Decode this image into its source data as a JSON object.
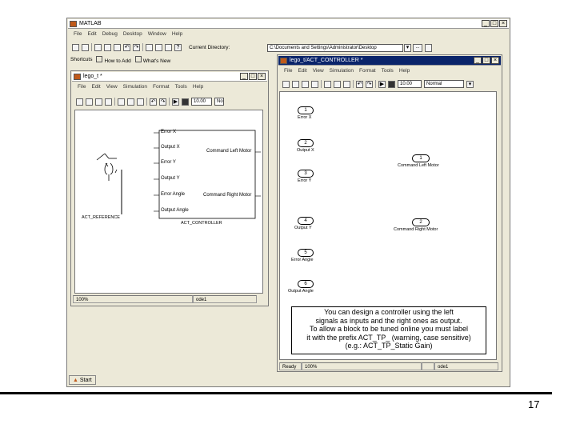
{
  "matlab": {
    "title": "MATLAB",
    "menus": [
      "File",
      "Edit",
      "Debug",
      "Desktop",
      "Window",
      "Help"
    ],
    "current_dir_label": "Current Directory:",
    "current_dir_value": "C:\\Documents and Settings\\Administrator\\Desktop",
    "browse_label": "...",
    "shortcuts": [
      "Shortcuts",
      "How to Add",
      "What's New"
    ],
    "start_label": "Start"
  },
  "lego_window": {
    "title": "lego_t *",
    "menus": [
      "File",
      "Edit",
      "View",
      "Simulation",
      "Format",
      "Tools",
      "Help"
    ],
    "stop_time": "10.00",
    "sim_mode_short": "No",
    "ref_block_label": "ACT_REFERENCE",
    "ctrl_inputs": [
      "Error X",
      "Output X",
      "Error Y",
      "Output Y",
      "Error Angle",
      "Output Angle"
    ],
    "ctrl_outputs": [
      "Command Left Motor",
      "Command Right Motor"
    ],
    "ctrl_block_label": "ACT_CONTROLLER",
    "status_zoom": "100%",
    "status_solver": "ode1"
  },
  "controller_window": {
    "title": "lego_t/ACT_CONTROLLER *",
    "menus": [
      "File",
      "Edit",
      "View",
      "Simulation",
      "Format",
      "Tools",
      "Help"
    ],
    "stop_time": "10.00",
    "sim_mode": "Normal",
    "inports": [
      {
        "num": "1",
        "label": "Error X"
      },
      {
        "num": "2",
        "label": "Output X"
      },
      {
        "num": "3",
        "label": "Error Y"
      },
      {
        "num": "4",
        "label": "Output Y"
      },
      {
        "num": "5",
        "label": "Error Angle"
      },
      {
        "num": "6",
        "label": "Output Angle"
      }
    ],
    "outports": [
      {
        "num": "1",
        "label": "Command Left Motor"
      },
      {
        "num": "2",
        "label": "Command Right Motor"
      }
    ],
    "note_lines": [
      "You can design a controller using the left",
      "signals as inputs and the right ones as output.",
      "To allow a block to be tuned online you must label",
      "it with the prefix ACT_TP_ (warning, case sensitive)",
      "(e.g.: ACT_TP_Static Gain)"
    ],
    "status_ready": "Ready",
    "status_zoom": "100%",
    "status_solver": "ode1"
  },
  "slide_number": "17"
}
